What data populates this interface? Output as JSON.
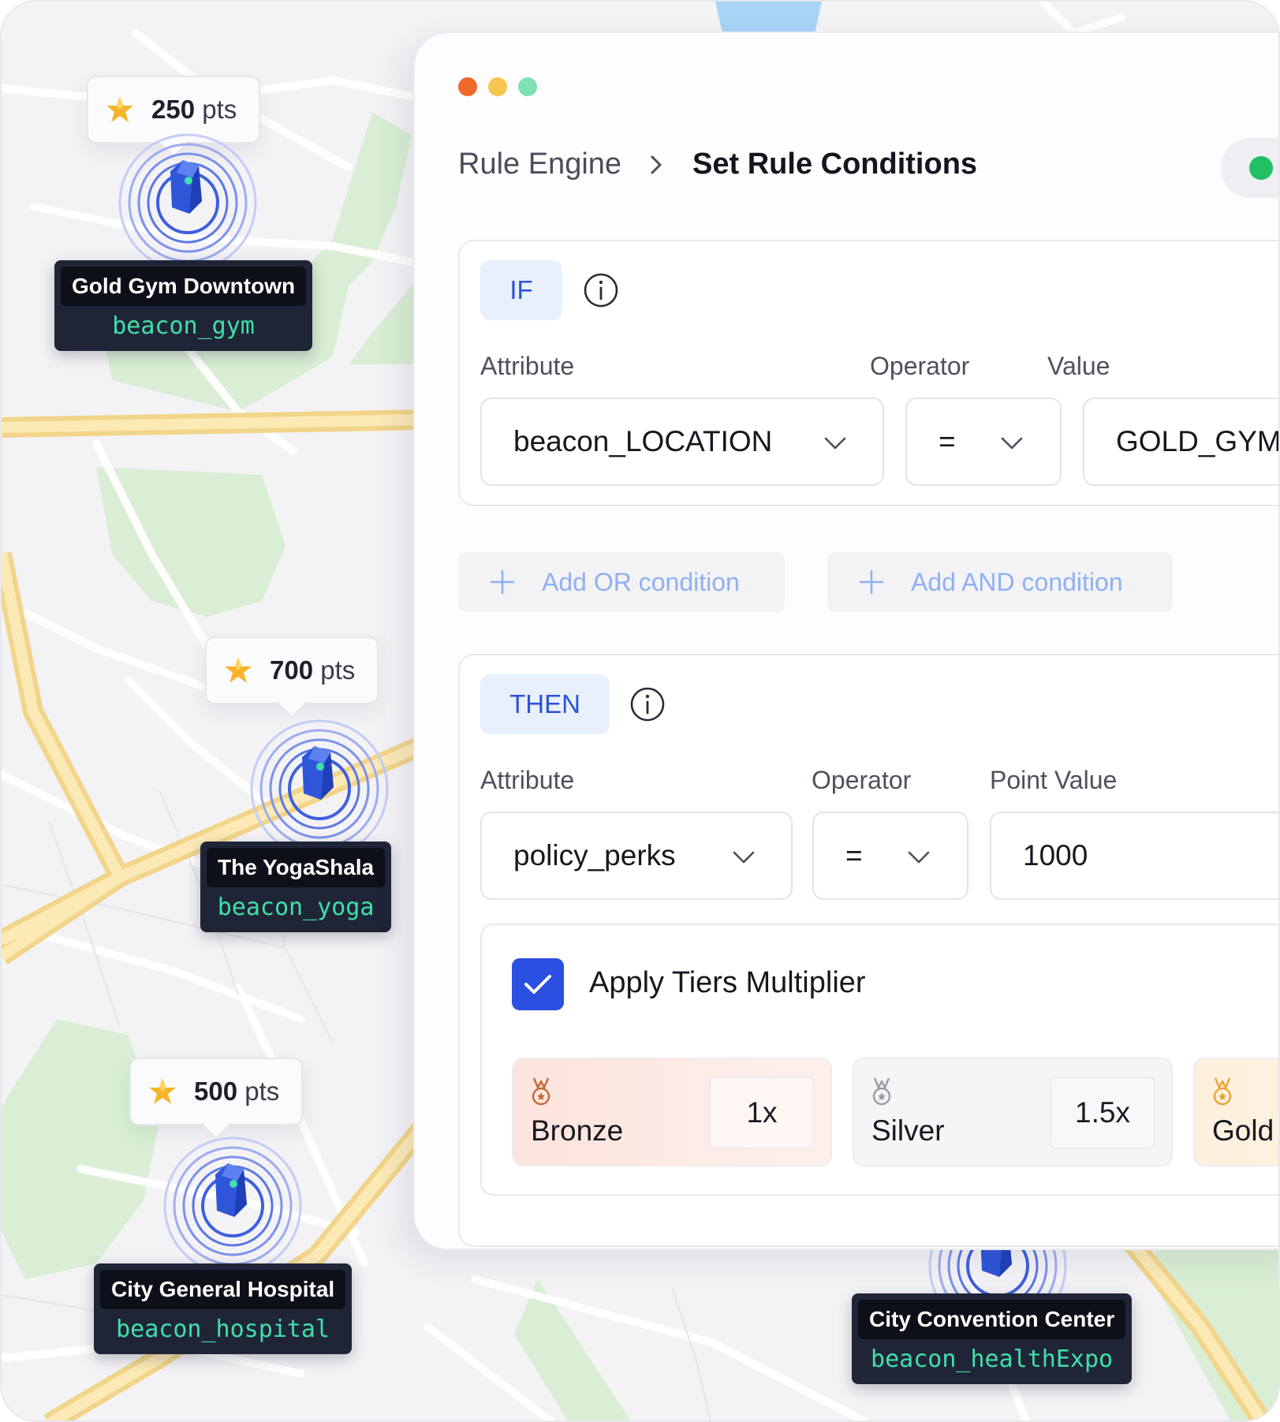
{
  "map": {
    "pins": [
      {
        "points": "250",
        "unit": "pts",
        "name": "Gold Gym Downtown",
        "beacon_id": "beacon_gym"
      },
      {
        "points": "700",
        "unit": "pts",
        "name": "The YogaShala",
        "beacon_id": "beacon_yoga"
      },
      {
        "points": "500",
        "unit": "pts",
        "name": "City General Hospital",
        "beacon_id": "beacon_hospital"
      },
      {
        "name": "City Convention Center",
        "beacon_id": "beacon_healthExpo"
      }
    ]
  },
  "window": {
    "controls": [
      "close",
      "minimize",
      "maximize"
    ],
    "control_colors": [
      "#f0682a",
      "#f6c64f",
      "#7fe0b2"
    ]
  },
  "breadcrumb": {
    "root": "Rule Engine",
    "current": "Set Rule Conditions",
    "status_color": "#20c063"
  },
  "if_block": {
    "tag": "IF",
    "info_icon": "info-icon",
    "attribute_label": "Attribute",
    "operator_label": "Operator",
    "value_label": "Value",
    "attribute_value": "beacon_LOCATION",
    "operator_value": "=",
    "value_value": "GOLD_GYM_"
  },
  "actions": {
    "add_or": "Add OR condition",
    "add_and": "Add AND condition"
  },
  "then_block": {
    "tag": "THEN",
    "info_icon": "info-icon",
    "attribute_label": "Attribute",
    "operator_label": "Operator",
    "point_value_label": "Point Value",
    "attribute_value": "policy_perks",
    "operator_value": "=",
    "point_value": "1000",
    "apply_tiers": {
      "label": "Apply Tiers Multiplier",
      "checked": true
    },
    "tiers": [
      {
        "name": "Bronze",
        "multiplier": "1x",
        "color": "#c0693a"
      },
      {
        "name": "Silver",
        "multiplier": "1.5x",
        "color": "#9a9aa4"
      },
      {
        "name": "Gold",
        "multiplier": "",
        "color": "#e9a436"
      }
    ]
  },
  "colors": {
    "accent": "#2b4fe0",
    "tag_text": "#2b52d6",
    "beacon_label_bg": "#1f2537",
    "beacon_id_text": "#3fe0a8"
  }
}
